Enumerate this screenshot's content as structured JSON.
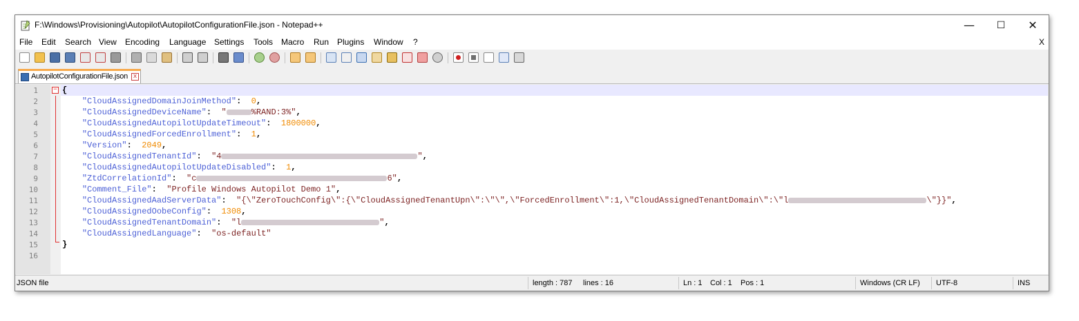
{
  "window": {
    "title": "F:\\Windows\\Provisioning\\Autopilot\\AutopilotConfigurationFile.json - Notepad++",
    "controls": {
      "minimize": "—",
      "maximize": "☐",
      "close": "✕"
    }
  },
  "menu": {
    "items": [
      "File",
      "Edit",
      "Search",
      "View",
      "Encoding",
      "Language",
      "Settings",
      "Tools",
      "Macro",
      "Run",
      "Plugins",
      "Window",
      "?"
    ],
    "close": "X"
  },
  "tab": {
    "label": "AutopilotConfigurationFile.json",
    "close": "x"
  },
  "editor": {
    "line_numbers": [
      "1",
      "2",
      "3",
      "4",
      "5",
      "6",
      "7",
      "8",
      "9",
      "10",
      "11",
      "12",
      "13",
      "14",
      "15",
      "16"
    ],
    "current_line": 1,
    "lines": {
      "l2_key": "\"CloudAssignedDomainJoinMethod\"",
      "l2_val": "0",
      "l3_key": "\"CloudAssignedDeviceName\"",
      "l3_val_a": "\"",
      "l3_val_b": "%RAND:3%\"",
      "l4_key": "\"CloudAssignedAutopilotUpdateTimeout\"",
      "l4_val": "1800000",
      "l5_key": "\"CloudAssignedForcedEnrollment\"",
      "l5_val": "1",
      "l6_key": "\"Version\"",
      "l6_val": "2049",
      "l7_key": "\"CloudAssignedTenantId\"",
      "l7_val_a": "\"4",
      "l7_val_b": "\"",
      "l8_key": "\"CloudAssignedAutopilotUpdateDisabled\"",
      "l8_val": "1",
      "l9_key": "\"ZtdCorrelationId\"",
      "l9_val_a": "\"c",
      "l9_val_b": "6\"",
      "l10_key": "\"Comment_File\"",
      "l10_val": "\"Profile Windows Autopilot Demo 1\"",
      "l11_key": "\"CloudAssignedAadServerData\"",
      "l11_val_a": "\"{\\\"ZeroTouchConfig\\\":{\\\"CloudAssignedTenantUpn\\\":\\\"\\\",\\\"ForcedEnrollment\\\":1,\\\"CloudAssignedTenantDomain\\\":\\\"l",
      "l11_val_b": "\\\"}}\"",
      "l12_key": "\"CloudAssignedOobeConfig\"",
      "l12_val": "1308",
      "l13_key": "\"CloudAssignedTenantDomain\"",
      "l13_val_a": "\"l",
      "l13_val_b": "\"",
      "l14_key": "\"CloudAssignedLanguage\"",
      "l14_val": "\"os-default\""
    }
  },
  "status": {
    "file_type": "JSON file",
    "length": "length : 787",
    "lines": "lines : 16",
    "ln": "Ln : 1",
    "col": "Col : 1",
    "pos": "Pos : 1",
    "eol": "Windows (CR LF)",
    "encoding": "UTF-8",
    "mode": "INS"
  },
  "colors": {
    "key": "#4b5fd6",
    "string": "#7d2323",
    "number": "#f08a00",
    "fold": "#e03030",
    "tab_accent": "#f7a94b"
  }
}
